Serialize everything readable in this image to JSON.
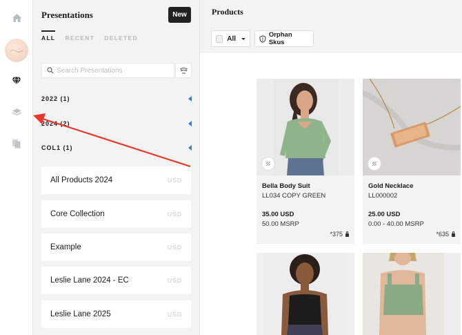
{
  "rail": {
    "icons": [
      "home-icon",
      "avatar",
      "diamond-icon",
      "layers-icon",
      "documents-icon"
    ]
  },
  "panel": {
    "title": "Presentations",
    "new_label": "New",
    "tabs": [
      {
        "label": "ALL",
        "active": true
      },
      {
        "label": "RECENT",
        "active": false
      },
      {
        "label": "DELETED",
        "active": false
      }
    ],
    "search_placeholder": "Search Presentations",
    "groups": [
      {
        "label": "2022 (1)"
      },
      {
        "label": "2024 (2)"
      },
      {
        "label": "COL1 (1)"
      }
    ],
    "presentations": [
      {
        "name": "All Products 2024",
        "currency": "USD"
      },
      {
        "name": "Core Collection",
        "currency": "USD"
      },
      {
        "name": "Example",
        "currency": "USD"
      },
      {
        "name": "Leslie Lane 2024 - EC",
        "currency": "USD"
      },
      {
        "name": "Leslie Lane 2025",
        "currency": "USD"
      }
    ]
  },
  "products": {
    "title": "Products",
    "all_label": "All",
    "orphan_label": "Orphan Skus",
    "items": [
      {
        "name": "Bella Body Suit",
        "sku": "LL034 COPY GREEN",
        "price": "35.00 USD",
        "msrp": "50.00 MSRP",
        "stock": "*375"
      },
      {
        "name": "Gold Necklace",
        "sku": "LL000002",
        "price": "25.00 USD",
        "msrp": "0.00 - 40.00 MSRP",
        "stock": "*635"
      },
      {
        "name": "",
        "sku": "",
        "price": "",
        "msrp": "",
        "stock": ""
      },
      {
        "name": "",
        "sku": "",
        "price": "",
        "msrp": "",
        "stock": ""
      }
    ]
  },
  "colors": {
    "accent_blue": "#2f7fd6",
    "annotation_red": "#e8392c",
    "dark_button": "#222222",
    "panel_bg": "#f3f3f3"
  }
}
